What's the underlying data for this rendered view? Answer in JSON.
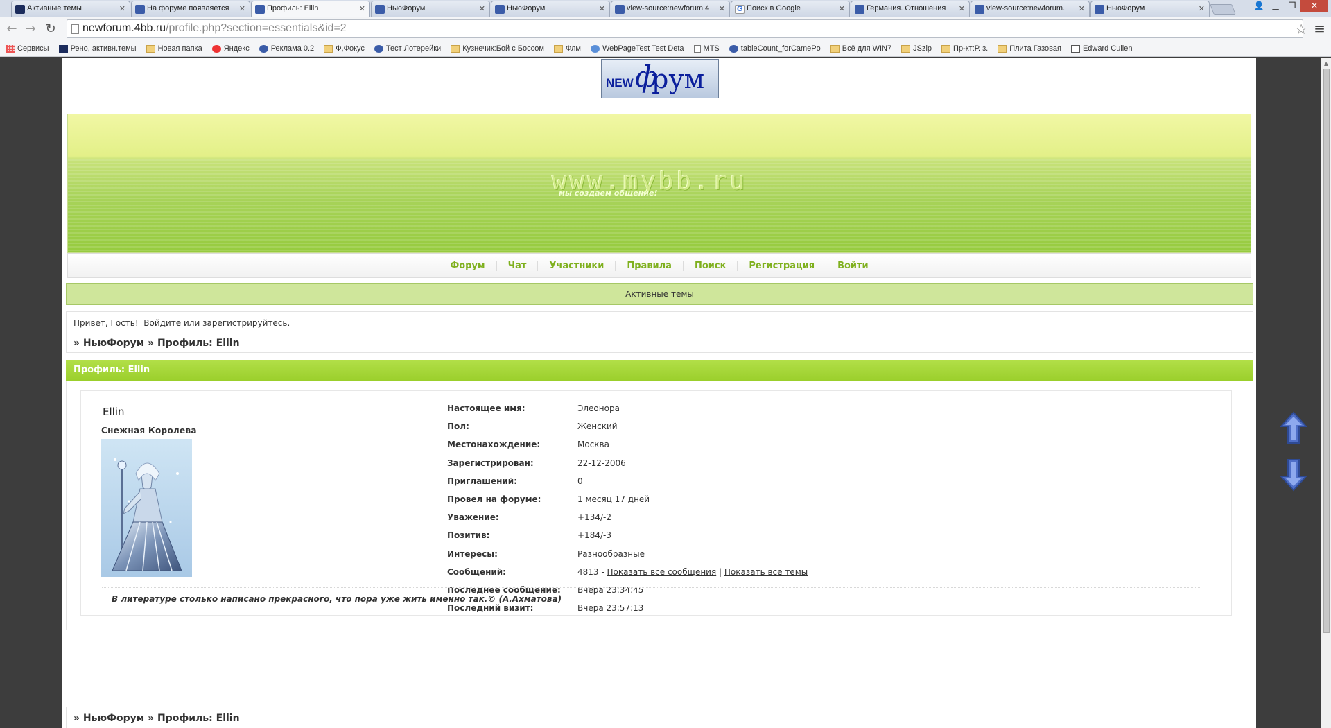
{
  "browser": {
    "tabs": [
      {
        "title": "Активные темы",
        "icon": "ps",
        "active": false
      },
      {
        "title": "На форуме появляется",
        "icon": "mybb",
        "active": false
      },
      {
        "title": "Профиль: Ellin",
        "icon": "mybb",
        "active": true
      },
      {
        "title": "НьюФорум",
        "icon": "mybb",
        "active": false
      },
      {
        "title": "НьюФорум",
        "icon": "mybb",
        "active": false
      },
      {
        "title": "view-source:newforum.4",
        "icon": "mybb",
        "active": false
      },
      {
        "title": "Поиск в Google",
        "icon": "goog",
        "active": false
      },
      {
        "title": "Германия. Отношения",
        "icon": "mybb",
        "active": false
      },
      {
        "title": "view-source:newforum.",
        "icon": "mybb",
        "active": false
      },
      {
        "title": "НьюФорум",
        "icon": "mybb",
        "active": false
      }
    ],
    "url_host": "newforum.4bb.ru",
    "url_path": "/profile.php?section=essentials&id=2",
    "bookmarks": [
      {
        "label": "Сервисы",
        "icon": "apps"
      },
      {
        "label": "Рено, активн.темы",
        "icon": "ps"
      },
      {
        "label": "Новая папка",
        "icon": "folder"
      },
      {
        "label": "Яндекс",
        "icon": "ya"
      },
      {
        "label": "Реклама 0.2",
        "icon": "mybb"
      },
      {
        "label": "Ф,Фокус",
        "icon": "folder"
      },
      {
        "label": "Тест Лотерейки",
        "icon": "mybb"
      },
      {
        "label": "Кузнечик:Бой с Боссом",
        "icon": "folder"
      },
      {
        "label": "Флм",
        "icon": "folder"
      },
      {
        "label": "WebPageTest Test Deta",
        "icon": "wpt"
      },
      {
        "label": "MTS",
        "icon": "page"
      },
      {
        "label": "tableCount_forCamePo",
        "icon": "mybb"
      },
      {
        "label": "Всё для WIN7",
        "icon": "folder"
      },
      {
        "label": "JSzip",
        "icon": "folder"
      },
      {
        "label": "Пр-кт:Р. з.",
        "icon": "folder"
      },
      {
        "label": "Плита Газовая",
        "icon": "folder"
      },
      {
        "label": "Edward Cullen",
        "icon": "book"
      }
    ]
  },
  "site": {
    "logo_new": "NEW",
    "logo_f": "ф",
    "logo_rest": "рум",
    "banner_text": "www.mybb.ru",
    "banner_sub": "мы создаем общение!",
    "nav": [
      "Форум",
      "Чат",
      "Участники",
      "Правила",
      "Поиск",
      "Регистрация",
      "Войти"
    ],
    "active_topics": "Активные темы"
  },
  "welcome": {
    "greeting": "Привет, Гость!",
    "login": "Войдите",
    "or": "или",
    "register": "зарегистрируйтесь",
    "dot": "."
  },
  "breadcrumb": {
    "sep": "»",
    "forum": "НьюФорум",
    "current": "» Профиль: Ellin"
  },
  "profile": {
    "header": "Профиль: Ellin",
    "username": "Ellin",
    "user_title": "Снежная Королева",
    "fields": [
      {
        "label": "Настоящее имя:",
        "value": "Элеонора",
        "link": false
      },
      {
        "label": "Пол:",
        "value": "Женский",
        "link": false
      },
      {
        "label": "Местонахождение:",
        "value": "Москва",
        "link": false
      },
      {
        "label": "Зарегистрирован:",
        "value": "22-12-2006",
        "link": false
      },
      {
        "label": "Приглашений",
        "value": "0",
        "link": true
      },
      {
        "label": "Провел на форуме:",
        "value": "1 месяц 17 дней",
        "link": false
      },
      {
        "label": "Уважение",
        "value": "+134/-2",
        "link": true
      },
      {
        "label": "Позитив",
        "value": "+184/-3",
        "link": true
      },
      {
        "label": "Интересы:",
        "value": "Разнообразные",
        "link": false
      },
      {
        "label": "Сообщений:",
        "value": "4813",
        "link": false
      },
      {
        "label": "Последнее сообщение:",
        "value": "Вчера 23:34:45",
        "link": false
      },
      {
        "label": "Последний визит:",
        "value": "Вчера 23:57:13",
        "link": false
      }
    ],
    "posts_dash": " - ",
    "show_posts": "Показать все сообщения",
    "pipe": " | ",
    "show_topics": "Показать все темы",
    "signature": "В литературе столько написано прекрасного, что пора уже  жить именно так.© (А.Ахматова)"
  }
}
